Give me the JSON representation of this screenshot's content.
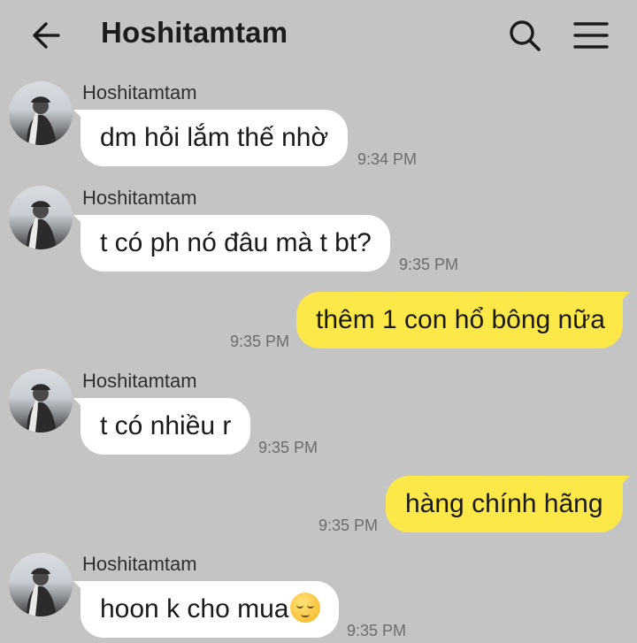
{
  "header": {
    "title": "Hoshitamtam",
    "back_icon": "arrow-left-icon",
    "search_icon": "search-icon",
    "menu_icon": "hamburger-menu-icon"
  },
  "messages": [
    {
      "direction": "in",
      "sender": "Hoshitamtam",
      "text": "dm hỏi lắm thế nhờ",
      "time": "9:34 PM"
    },
    {
      "direction": "in",
      "sender": "Hoshitamtam",
      "text": "t có ph nó đâu mà t bt?",
      "time": "9:35 PM"
    },
    {
      "direction": "out",
      "text": "thêm 1 con hổ bông nữa",
      "time": "9:35 PM"
    },
    {
      "direction": "in",
      "sender": "Hoshitamtam",
      "text": "t có nhiều r",
      "time": "9:35 PM"
    },
    {
      "direction": "out",
      "text": "hàng chính hãng",
      "time": "9:35 PM"
    },
    {
      "direction": "in",
      "sender": "Hoshitamtam",
      "text": "hoon k cho mua",
      "emoji": "pensive-face-emoji",
      "time": "9:35 PM"
    }
  ],
  "colors": {
    "background": "#c4c4c4",
    "incoming_bubble": "#ffffff",
    "outgoing_bubble": "#fde84a"
  }
}
